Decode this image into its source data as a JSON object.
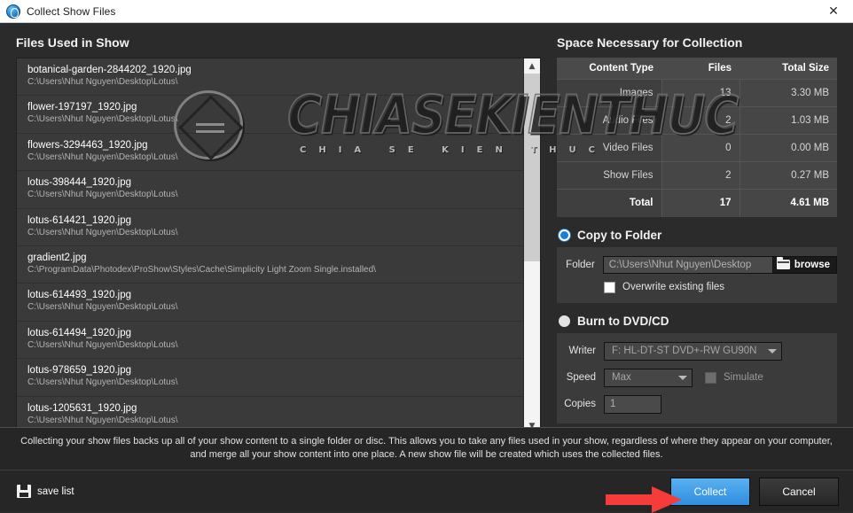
{
  "window": {
    "title": "Collect Show Files",
    "app_icon": "proshow-icon",
    "close_icon": "close-icon"
  },
  "left_panel": {
    "title": "Files Used in Show",
    "files": [
      {
        "name": "botanical-garden-2844202_1920.jpg",
        "path": "C:\\Users\\Nhut Nguyen\\Desktop\\Lotus\\"
      },
      {
        "name": "flower-197197_1920.jpg",
        "path": "C:\\Users\\Nhut Nguyen\\Desktop\\Lotus\\"
      },
      {
        "name": "flowers-3294463_1920.jpg",
        "path": "C:\\Users\\Nhut Nguyen\\Desktop\\Lotus\\"
      },
      {
        "name": "lotus-398444_1920.jpg",
        "path": "C:\\Users\\Nhut Nguyen\\Desktop\\Lotus\\"
      },
      {
        "name": "lotus-614421_1920.jpg",
        "path": "C:\\Users\\Nhut Nguyen\\Desktop\\Lotus\\"
      },
      {
        "name": "gradient2.jpg",
        "path": "C:\\ProgramData\\Photodex\\ProShow\\Styles\\Cache\\Simplicity Light Zoom Single.installed\\"
      },
      {
        "name": "lotus-614493_1920.jpg",
        "path": "C:\\Users\\Nhut Nguyen\\Desktop\\Lotus\\"
      },
      {
        "name": "lotus-614494_1920.jpg",
        "path": "C:\\Users\\Nhut Nguyen\\Desktop\\Lotus\\"
      },
      {
        "name": "lotus-978659_1920.jpg",
        "path": "C:\\Users\\Nhut Nguyen\\Desktop\\Lotus\\"
      },
      {
        "name": "lotus-1205631_1920.jpg",
        "path": "C:\\Users\\Nhut Nguyen\\Desktop\\Lotus\\"
      }
    ],
    "scrollbar": {
      "up_arrow": "▲",
      "down_arrow": "▼"
    }
  },
  "watermark": {
    "main": "CHIASEKIENTHUC",
    "sub": "CHIA SE KIEN THUC"
  },
  "right_panel": {
    "title": "Space Necessary for Collection",
    "table": {
      "headers": [
        "Content Type",
        "Files",
        "Total Size"
      ],
      "rows": [
        {
          "type": "Images",
          "files": "13",
          "size": "3.30 MB"
        },
        {
          "type": "Audio Files",
          "files": "2",
          "size": "1.03 MB"
        },
        {
          "type": "Video Files",
          "files": "0",
          "size": "0.00 MB"
        },
        {
          "type": "Show Files",
          "files": "2",
          "size": "0.27 MB"
        },
        {
          "type": "Total",
          "files": "17",
          "size": "4.61 MB"
        }
      ]
    },
    "copy_to_folder": {
      "label": "Copy to Folder",
      "selected": true,
      "folder_label": "Folder",
      "folder_value": "C:\\Users\\Nhut Nguyen\\Desktop",
      "browse_label": "browse",
      "browse_icon": "folder-icon",
      "overwrite_label": "Overwrite existing files",
      "overwrite_checked": false
    },
    "burn_to_disc": {
      "label": "Burn to DVD/CD",
      "selected": false,
      "writer_label": "Writer",
      "writer_value": "F: HL-DT-ST DVD+-RW GU90N",
      "speed_label": "Speed",
      "speed_value": "Max",
      "simulate_label": "Simulate",
      "simulate_checked": false,
      "copies_label": "Copies",
      "copies_value": "1"
    }
  },
  "footer": {
    "description": "Collecting your show files backs up all of your show content to a single folder or disc. This allows you to take any files used in your show, regardless of where they appear on your computer, and merge all your show content into one place. A new show file will be created which uses the collected files.",
    "save_list_label": "save list",
    "save_list_icon": "save-icon",
    "collect_label": "Collect",
    "cancel_label": "Cancel"
  },
  "colors": {
    "accent": "#2f8ee0",
    "radio_on": "#1a7fd4",
    "cursor_arrow": "#f63b3b",
    "dialog_bg": "#2b2b2b"
  }
}
